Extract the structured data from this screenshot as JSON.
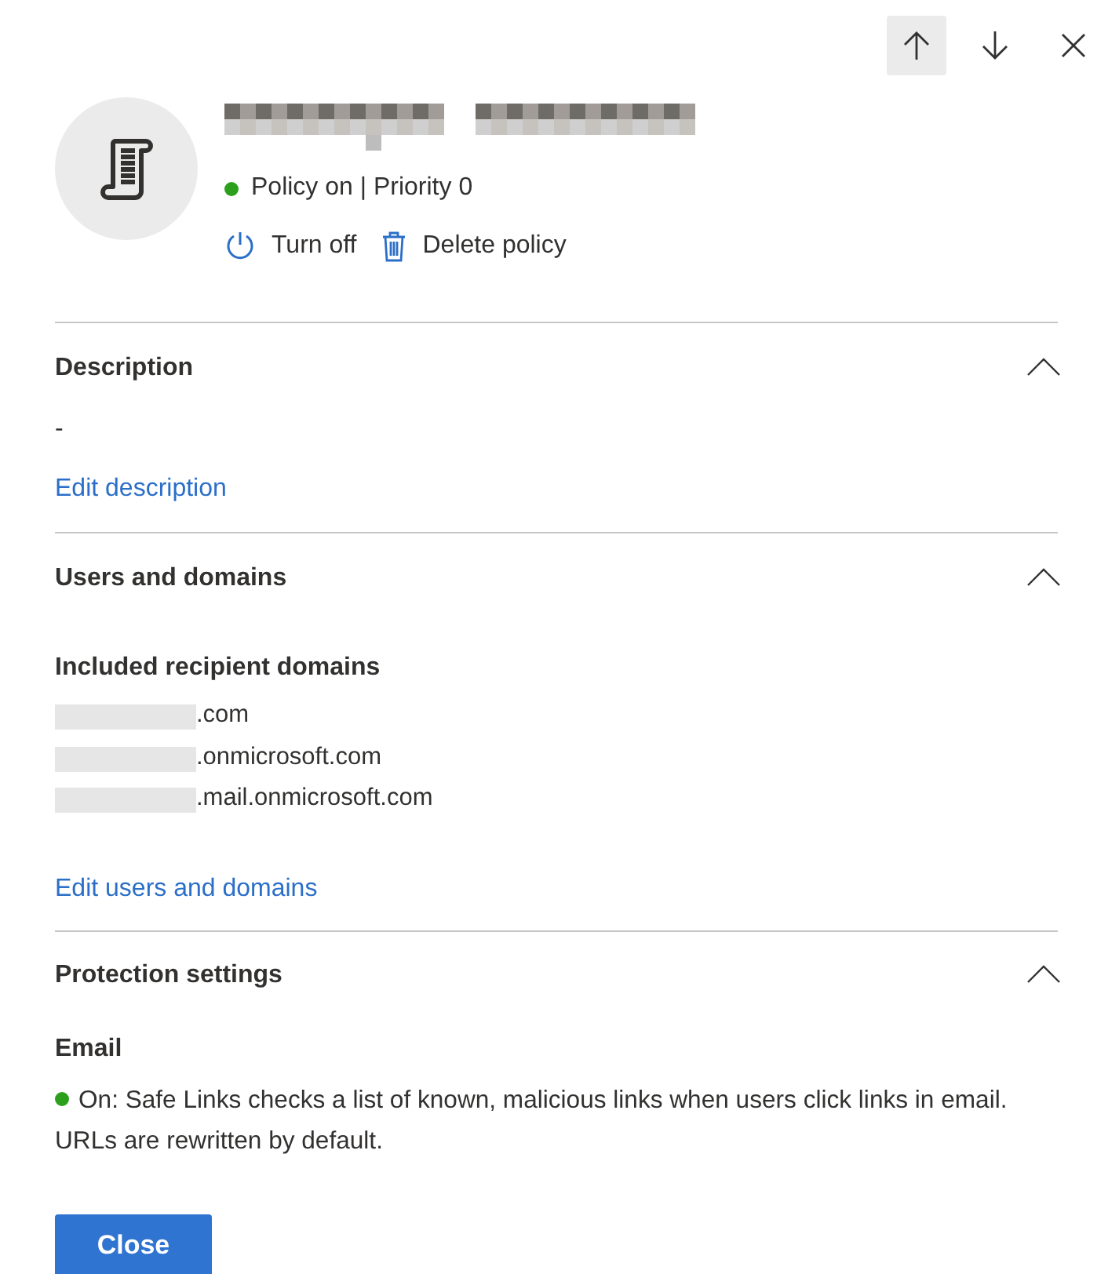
{
  "nav": {
    "buttons": [
      {
        "kind": "up",
        "selected": true
      },
      {
        "kind": "down",
        "selected": false
      },
      {
        "kind": "close",
        "selected": false
      }
    ]
  },
  "policy": {
    "on": true,
    "status": "Policy on | Priority 0"
  },
  "actions": [
    {
      "kind": "power",
      "label": "Turn off"
    },
    {
      "kind": "delete",
      "label": "Delete policy"
    }
  ],
  "sections": [
    {
      "kind": "description",
      "title": "Description",
      "expanded": true,
      "text": "-",
      "link": "Edit description"
    },
    {
      "kind": "domains",
      "title": "Users and domains",
      "expanded": true,
      "subheading": "Included recipient domains",
      "domains": [
        ".com",
        ".onmicrosoft.com",
        ".mail.onmicrosoft.com"
      ],
      "link": "Edit users and domains"
    },
    {
      "kind": "protection",
      "title": "Protection settings",
      "expanded": true,
      "subheading": "Email",
      "on": true,
      "text": "On: Safe Links checks a list of known, malicious links when users click links in email. URLs are rewritten by default."
    }
  ],
  "close_button": "Close"
}
